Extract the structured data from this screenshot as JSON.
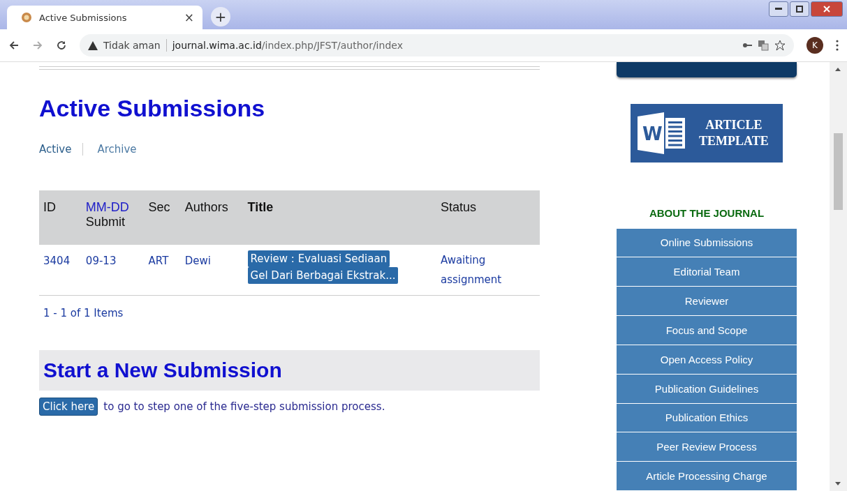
{
  "browser": {
    "tab_title": "Active Submissions",
    "new_tab": "+",
    "close": "×",
    "security": "Tidak aman",
    "url_host": "journal.wima.ac.id",
    "url_path": "/index.php/JFST/author/index",
    "profile": "K"
  },
  "page": {
    "title": "Active Submissions",
    "subtabs": [
      {
        "label": "Active",
        "selected": true
      },
      {
        "label": "Archive",
        "selected": false
      }
    ],
    "table": {
      "columns": [
        {
          "kind": "plain",
          "label": "ID"
        },
        {
          "kind": "split",
          "link": "MM-DD",
          "label": "Submit"
        },
        {
          "kind": "plain",
          "label": "Sec"
        },
        {
          "kind": "plain",
          "label": "Authors"
        },
        {
          "kind": "bold",
          "label": "Title"
        },
        {
          "kind": "plain",
          "label": "Status"
        }
      ],
      "rows": [
        {
          "id": "3404",
          "date": "09-13",
          "sec": "ART",
          "authors": "Dewi",
          "title_lines": [
            "Review : Evaluasi Sediaan",
            "Gel Dari Berbagai Ekstrak..."
          ],
          "title_highlighted": true,
          "status": "Awaiting assignment"
        }
      ],
      "pager": "1 - 1 of 1 Items"
    },
    "new_title": "Start a New Submission",
    "click_button": "Click here",
    "click_text": "to go to step one of the five-step submission process."
  },
  "sidebar": {
    "banner_lines": [
      "ARTICLE",
      "TEMPLATE"
    ],
    "banner_letter": "W",
    "heading": "ABOUT THE JOURNAL",
    "menu": [
      "Online Submissions",
      "Editorial Team",
      "Reviewer",
      "Focus and Scope",
      "Open Access Policy",
      "Publication Guidelines",
      "Publication Ethics",
      "Peer Review Process",
      "Article Processing Charge"
    ]
  }
}
